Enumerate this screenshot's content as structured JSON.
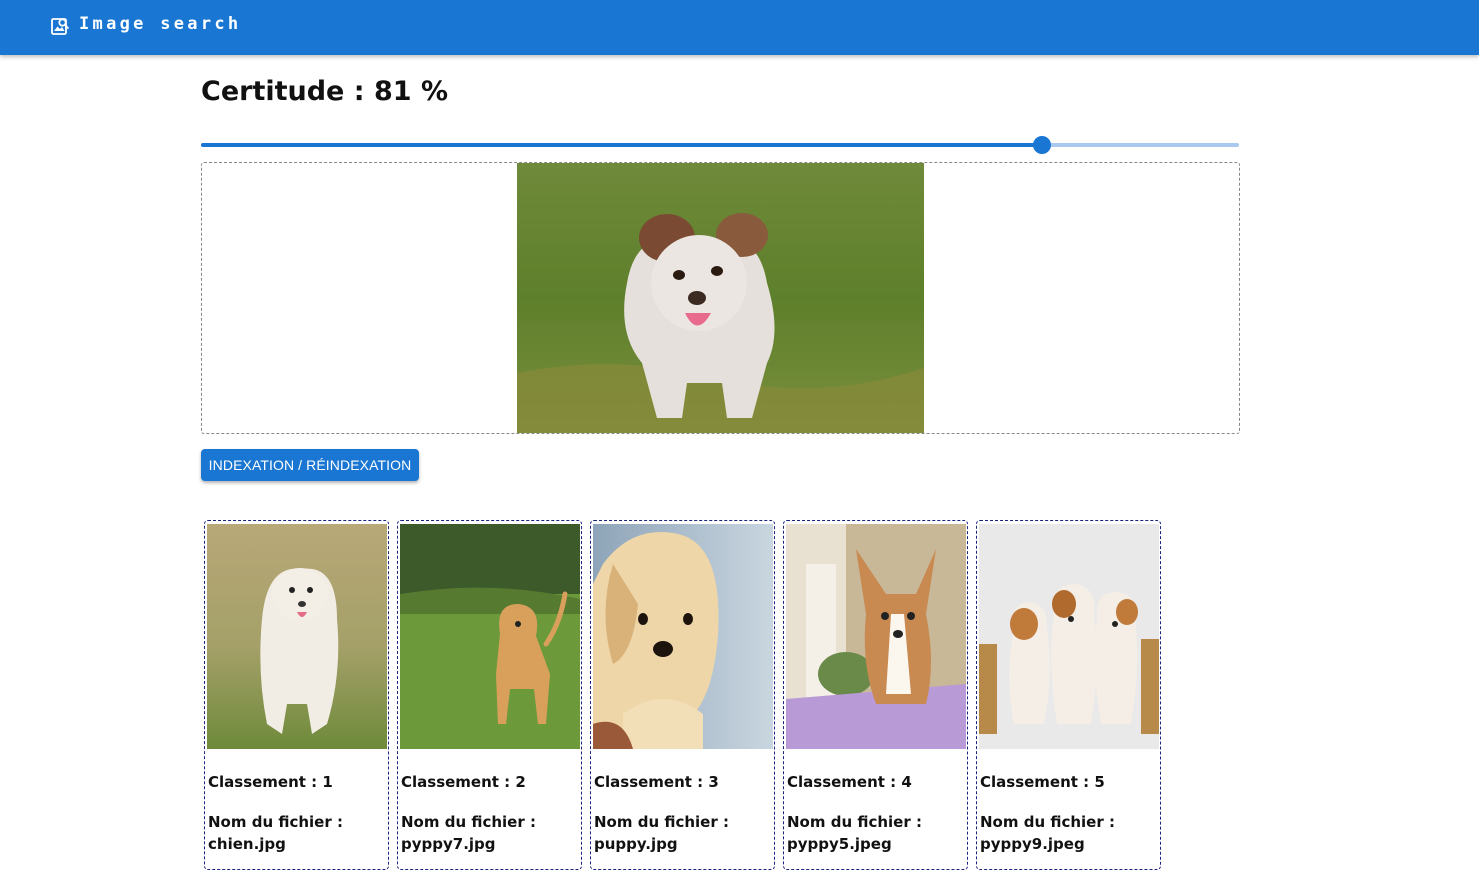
{
  "app": {
    "title": "Image search",
    "logo_icon": "image-search-icon"
  },
  "certitude": {
    "heading": "Certitude : 81 %",
    "value_percent": 81
  },
  "upload": {
    "image_alt": "puppy running on grass"
  },
  "actions": {
    "index_label": "INDEXATION / RÉINDEXATION"
  },
  "colors": {
    "primary": "#1976d2",
    "card_border": "#1a237e"
  },
  "results": [
    {
      "rank": "Classement : 1",
      "file_label": "Nom du fichier :",
      "file_name": "chien.jpg",
      "alt": "white puppy running on grass"
    },
    {
      "rank": "Classement : 2",
      "file_label": "Nom du fichier :",
      "file_name": "pyppy7.jpg",
      "alt": "golden retriever puppy on lawn"
    },
    {
      "rank": "Classement : 3",
      "file_label": "Nom du fichier :",
      "file_name": "puppy.jpg",
      "alt": "labrador puppy close-up"
    },
    {
      "rank": "Classement : 4",
      "file_label": "Nom du fichier :",
      "file_name": "pyppy5.jpeg",
      "alt": "corgi puppy sitting"
    },
    {
      "rank": "Classement : 5",
      "file_label": "Nom du fichier :",
      "file_name": "pyppy9.jpeg",
      "alt": "three puppies with books"
    }
  ]
}
